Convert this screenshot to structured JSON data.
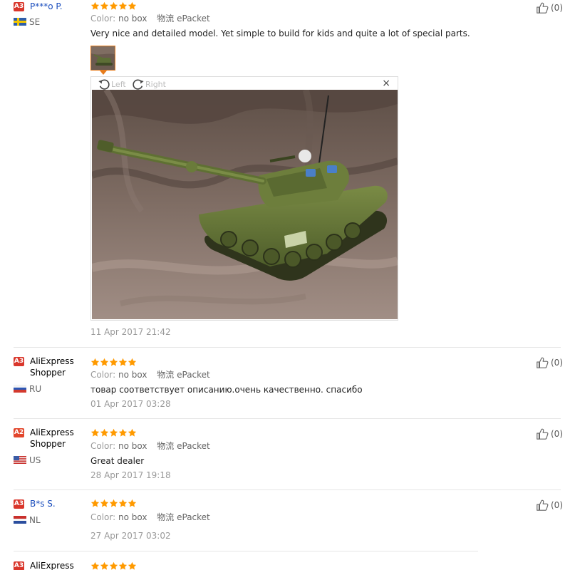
{
  "reviews": [
    {
      "level": "A3",
      "name": "P***o P.",
      "country": "SE",
      "stars": 5,
      "color_key": "Color:",
      "color_val": "no box",
      "shipping_zh": "物流",
      "shipping": "ePacket",
      "text": "Very nice and detailed model. Yet simple to build for kids and quite a lot of special parts.",
      "date": "11 Apr 2017 21:42",
      "likes": "(0)"
    },
    {
      "level": "A3",
      "name": "AliExpress Shopper",
      "country": "RU",
      "stars": 5,
      "color_key": "Color:",
      "color_val": "no box",
      "shipping_zh": "物流",
      "shipping": "ePacket",
      "text": "товар соответствует описанию.очень качественно. спасибо",
      "date": "01 Apr 2017 03:28",
      "likes": "(0)"
    },
    {
      "level": "A2",
      "name": "AliExpress Shopper",
      "country": "US",
      "stars": 5,
      "color_key": "Color:",
      "color_val": "no box",
      "shipping_zh": "物流",
      "shipping": "ePacket",
      "text": "Great dealer",
      "date": "28 Apr 2017 19:18",
      "likes": "(0)"
    },
    {
      "level": "A3",
      "name": "B*s S.",
      "country": "NL",
      "stars": 5,
      "color_key": "Color:",
      "color_val": "no box",
      "shipping_zh": "物流",
      "shipping": "ePacket",
      "date": "27 Apr 2017 03:02",
      "likes": "(0)"
    },
    {
      "level": "A3",
      "name": "AliExpress",
      "stars": 5
    }
  ],
  "viewer": {
    "rotate_left": "Left",
    "rotate_right": "Right",
    "close": "×"
  },
  "colors": {
    "level_a3": "#d9362b",
    "level_a2": "#e2452b",
    "star": "#ff9a00",
    "name_link": "#1a4dbd",
    "active_border": "#e77c1c"
  }
}
